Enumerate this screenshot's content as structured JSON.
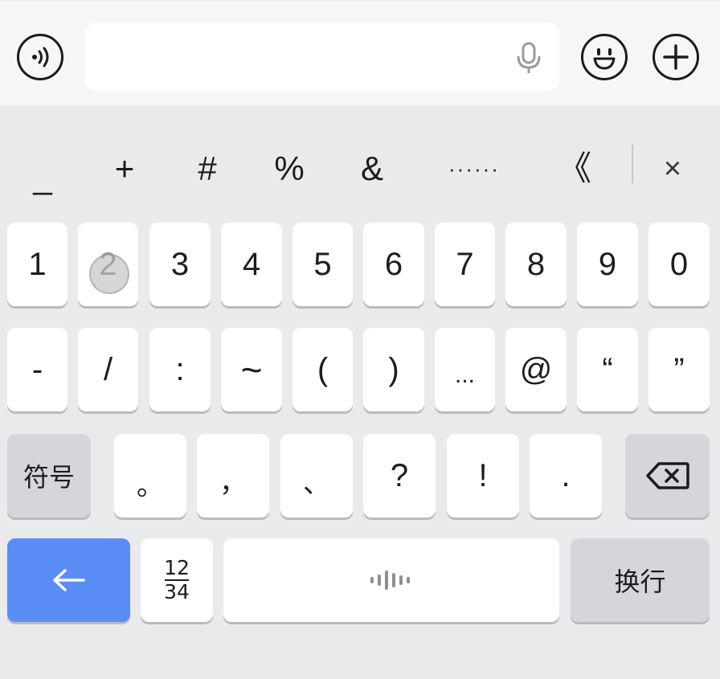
{
  "top_bar": {
    "voice_icon": "voice-wave-icon",
    "input_value": "",
    "mic_icon": "microphone-icon",
    "emoji_icon": "smiley-face-icon",
    "plus_icon": "plus-circle-icon"
  },
  "candidates": {
    "items": [
      "_",
      "+",
      "#",
      "%",
      "&",
      "······",
      "《"
    ],
    "close_label": "×"
  },
  "keyboard": {
    "row1": [
      "1",
      "2",
      "3",
      "4",
      "5",
      "6",
      "7",
      "8",
      "9",
      "0"
    ],
    "row2": [
      "-",
      "/",
      ":",
      "~",
      "(",
      ")",
      "...",
      "@",
      "“",
      "”"
    ],
    "row3": {
      "symbol_label": "符号",
      "keys": [
        "。",
        "，",
        "、",
        "?",
        "!",
        "."
      ],
      "backspace_icon": "backspace-icon"
    },
    "row4": {
      "back_icon": "left-arrow-icon",
      "numbers_top": "12",
      "numbers_bottom": "34",
      "space_icon": "sound-wave-icon",
      "enter_label": "换行"
    }
  },
  "colors": {
    "accent": "#5a8cf6",
    "key_bg": "#ffffff",
    "function_key_bg": "#d5d6da",
    "keyboard_bg": "#e9eaec"
  }
}
